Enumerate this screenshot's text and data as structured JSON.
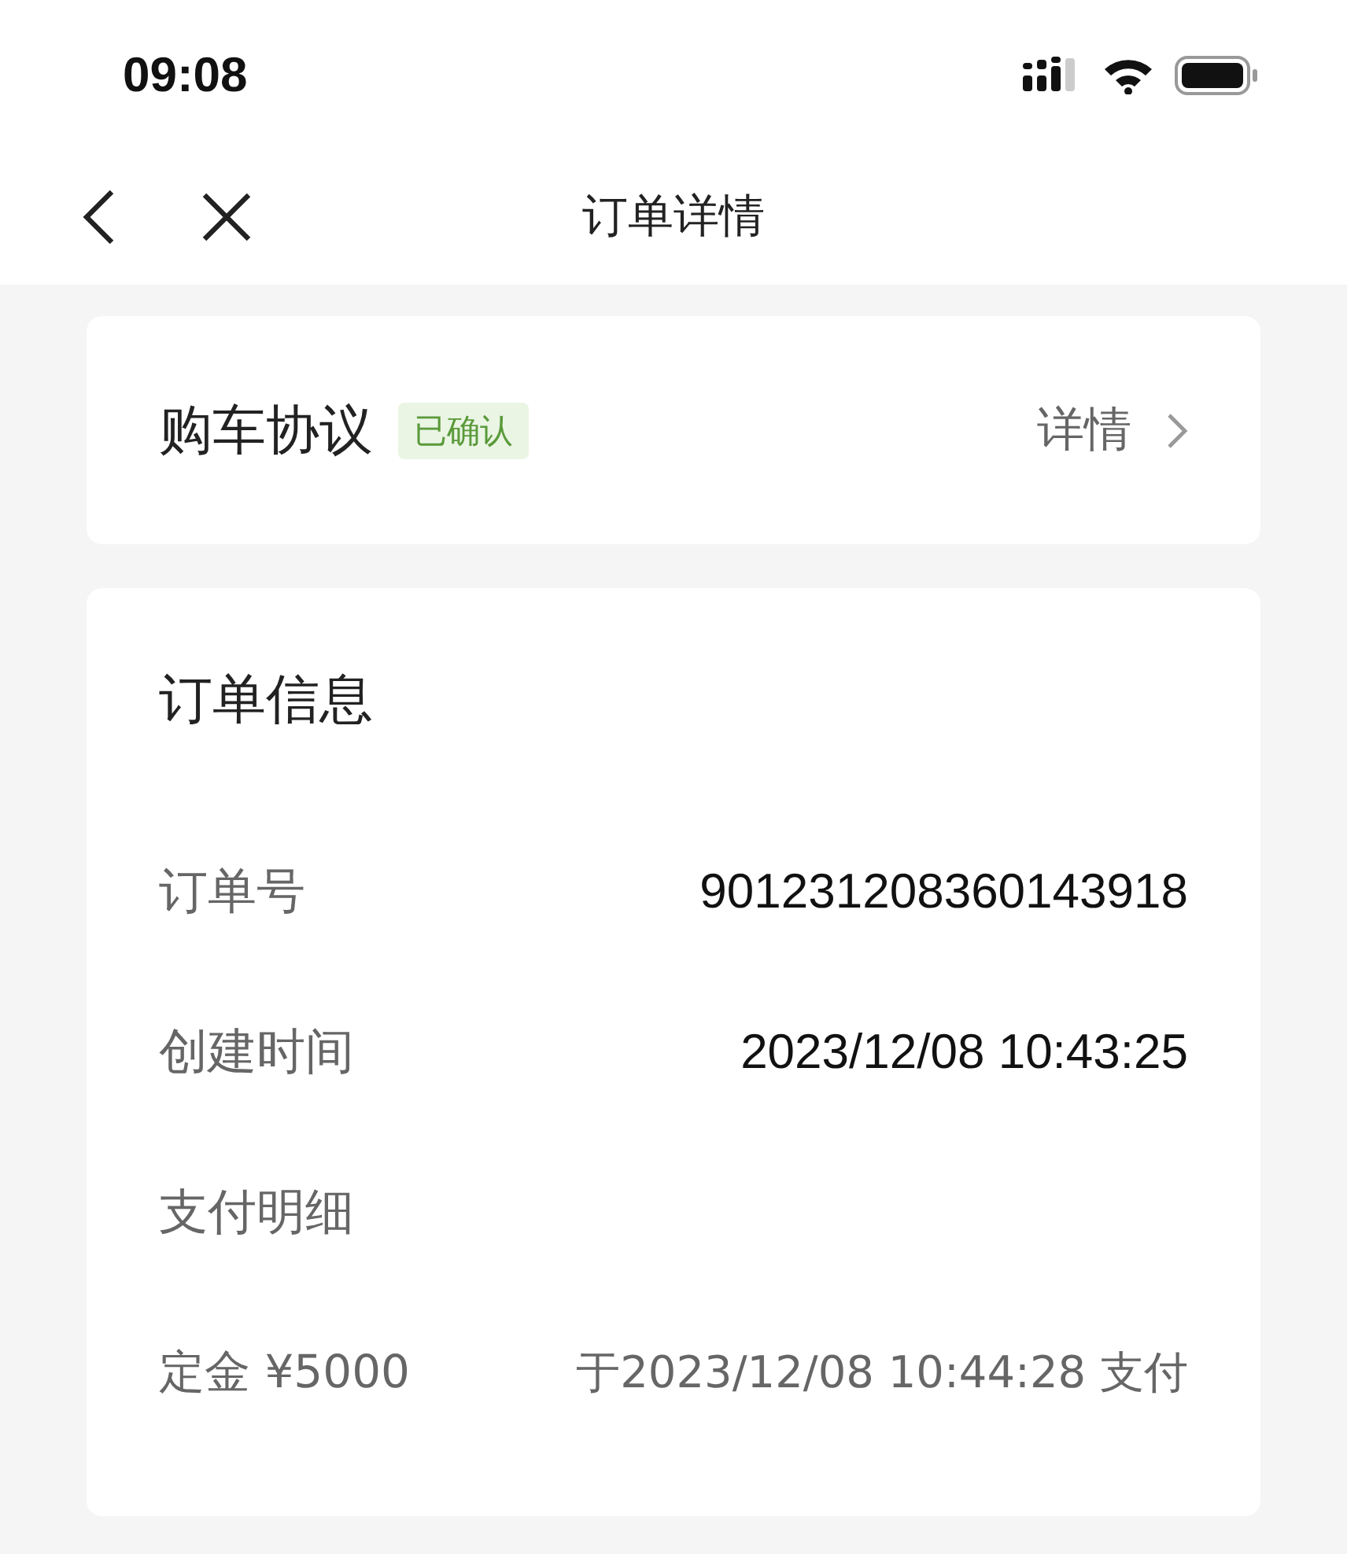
{
  "status_bar": {
    "time": "09:08"
  },
  "nav": {
    "title": "订单详情"
  },
  "agreement": {
    "title": "购车协议",
    "badge": "已确认",
    "link": "详情"
  },
  "order_info": {
    "title": "订单信息",
    "rows": [
      {
        "label": "订单号",
        "value": "901231208360143918"
      },
      {
        "label": "创建时间",
        "value": "2023/12/08 10:43:25"
      }
    ],
    "payment": {
      "title": "支付明细",
      "items": [
        {
          "label": "定金 ¥5000",
          "value": "于2023/12/08 10:44:28 支付"
        }
      ]
    }
  }
}
